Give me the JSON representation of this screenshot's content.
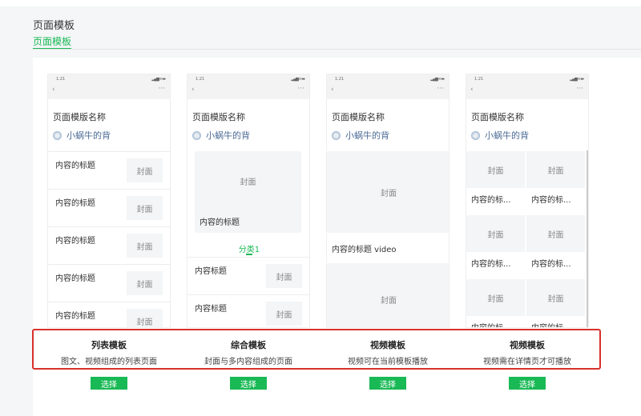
{
  "header": {
    "title": "页面模板",
    "breadcrumb": "页面模板"
  },
  "phone_common": {
    "time": "1:21",
    "signal": "▂▄▆ ≋ ▬",
    "back": "‹",
    "more": "···",
    "page_name": "页面模版名称",
    "author": "小蜗牛的背"
  },
  "phone_list": {
    "rows": [
      "内容的标题",
      "内容的标题",
      "内容的标题",
      "内容的标题",
      "内容的标题"
    ],
    "cover": "封面"
  },
  "phone_mixed": {
    "hero_cover": "封面",
    "hero_title": "内容的标题",
    "tab": "分类1",
    "rows": [
      "内容标题",
      "内容标题"
    ],
    "cover": "封面"
  },
  "phone_video": {
    "cover": "封面",
    "title": "内容的标题 video",
    "cover2": "封面"
  },
  "phone_grid": {
    "cover": "封面",
    "item_title": "内容的标..."
  },
  "templates": [
    {
      "name": "列表模板",
      "desc": "图文、视频组成的列表页面",
      "button": "选择"
    },
    {
      "name": "综合模板",
      "desc": "封面与多内容组成的页面",
      "button": "选择"
    },
    {
      "name": "视频模板",
      "desc": "视频可在当前模板播放",
      "button": "选择"
    },
    {
      "name": "视频模板",
      "desc": "视频需在详情页才可播放",
      "button": "选择"
    }
  ],
  "colors": {
    "accent": "#19b955",
    "highlight": "#d8312b"
  }
}
